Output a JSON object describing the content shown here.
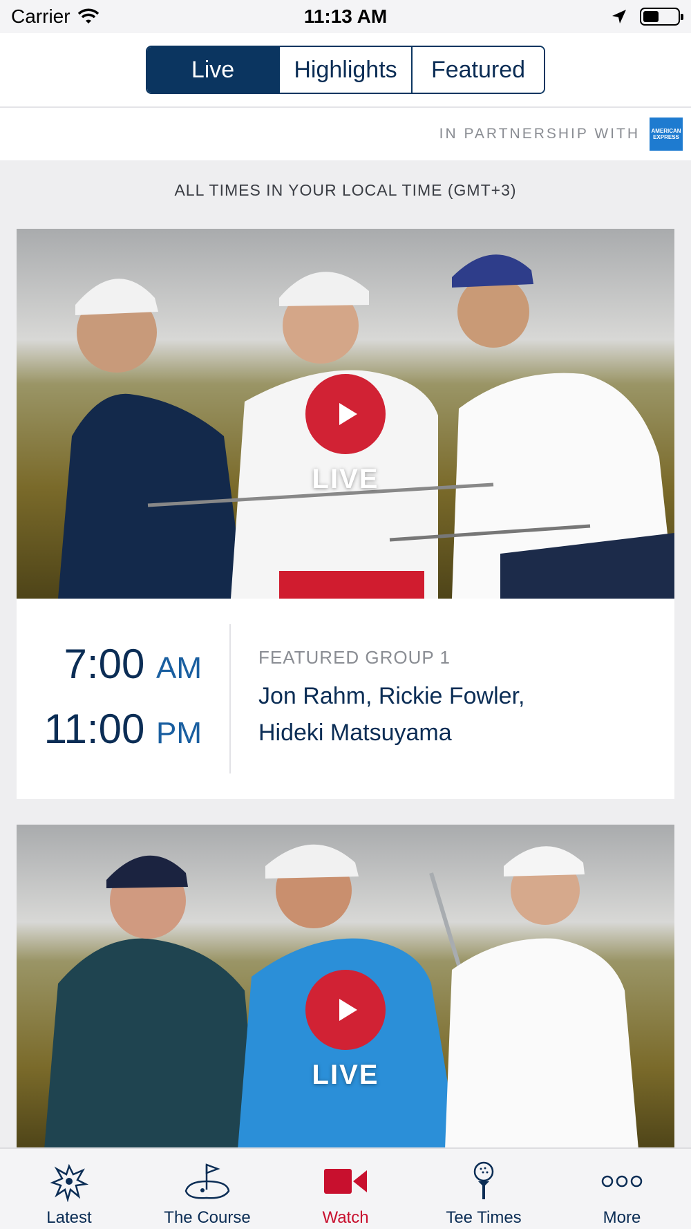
{
  "status_bar": {
    "carrier": "Carrier",
    "time": "11:13 AM"
  },
  "segments": [
    {
      "label": "Live",
      "active": true
    },
    {
      "label": "Highlights",
      "active": false
    },
    {
      "label": "Featured",
      "active": false
    }
  ],
  "partnership": {
    "text": "IN PARTNERSHIP WITH",
    "logo_text": "AMERICAN EXPRESS"
  },
  "local_time_note": "ALL TIMES IN YOUR LOCAL TIME (GMT+3)",
  "cards": [
    {
      "live_label": "LIVE",
      "start_time": "7:00",
      "start_ampm": "AM",
      "end_time": "11:00",
      "end_ampm": "PM",
      "group": "FEATURED GROUP 1",
      "players": "Jon Rahm, Rickie Fowler, Hideki Matsuyama"
    },
    {
      "live_label": "LIVE"
    }
  ],
  "tabs": [
    {
      "label": "Latest",
      "icon": "eagle-logo-icon",
      "active": false
    },
    {
      "label": "The Course",
      "icon": "flag-green-icon",
      "active": false
    },
    {
      "label": "Watch",
      "icon": "video-camera-icon",
      "active": true
    },
    {
      "label": "Tee Times",
      "icon": "golf-tee-icon",
      "active": false
    },
    {
      "label": "More",
      "icon": "more-dots-icon",
      "active": false
    }
  ],
  "colors": {
    "navy": "#0b3560",
    "accent_red": "#c8102e",
    "play_red": "#d12234"
  }
}
